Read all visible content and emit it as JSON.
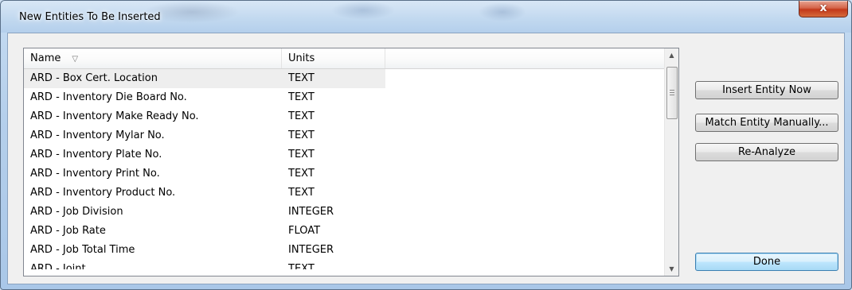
{
  "window": {
    "title": "New Entities To Be Inserted",
    "close_glyph": "x"
  },
  "list": {
    "columns": {
      "name": "Name",
      "units": "Units"
    },
    "sort_glyph": "▽",
    "rows": [
      {
        "name": "ARD - Box Cert. Location",
        "units": "TEXT"
      },
      {
        "name": "ARD - Inventory Die Board No.",
        "units": "TEXT"
      },
      {
        "name": "ARD - Inventory Make Ready No.",
        "units": "TEXT"
      },
      {
        "name": "ARD - Inventory Mylar No.",
        "units": "TEXT"
      },
      {
        "name": "ARD - Inventory Plate No.",
        "units": "TEXT"
      },
      {
        "name": "ARD - Inventory Print No.",
        "units": "TEXT"
      },
      {
        "name": "ARD - Inventory Product No.",
        "units": "TEXT"
      },
      {
        "name": "ARD - Job Division",
        "units": "INTEGER"
      },
      {
        "name": "ARD - Job Rate",
        "units": "FLOAT"
      },
      {
        "name": "ARD - Job Total Time",
        "units": "INTEGER"
      },
      {
        "name": "ARD - Joint",
        "units": "TEXT"
      }
    ]
  },
  "scrollbar": {
    "up_glyph": "▲",
    "down_glyph": "▼"
  },
  "buttons": {
    "insert": "Insert Entity Now",
    "match": "Match Entity Manually...",
    "reanalyze": "Re-Analyze",
    "done": "Done"
  }
}
